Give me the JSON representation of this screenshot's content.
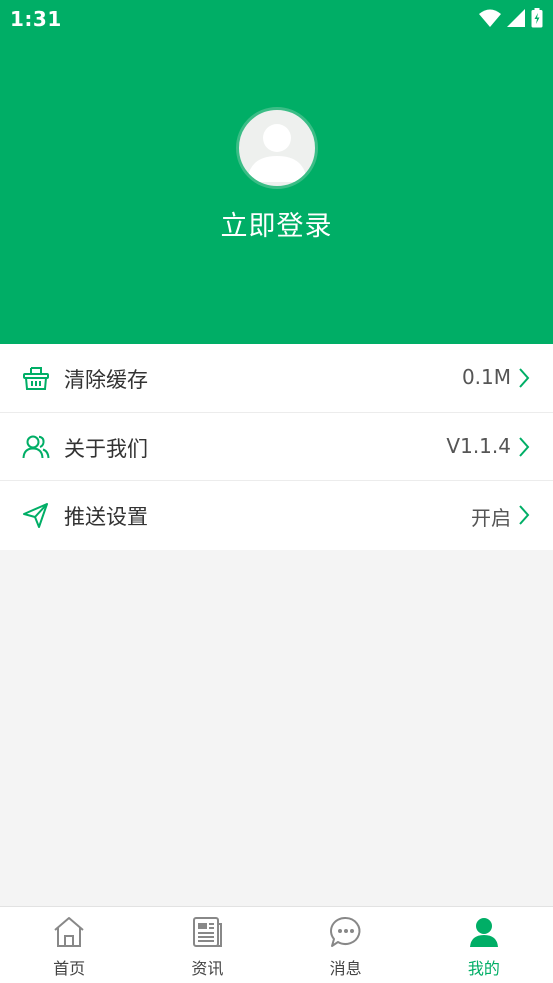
{
  "status_bar": {
    "time": "1:31"
  },
  "profile": {
    "login_text": "立即登录"
  },
  "menu": {
    "items": [
      {
        "label": "清除缓存",
        "value": "0.1M",
        "icon": "basket-icon"
      },
      {
        "label": "关于我们",
        "value": "V1.1.4",
        "icon": "users-icon"
      },
      {
        "label": "推送设置",
        "value": "开启",
        "icon": "send-icon"
      }
    ]
  },
  "tabbar": {
    "active": "我的",
    "tabs": [
      {
        "label": "首页",
        "icon": "home-icon"
      },
      {
        "label": "资讯",
        "icon": "news-icon"
      },
      {
        "label": "消息",
        "icon": "message-icon"
      },
      {
        "label": "我的",
        "icon": "person-icon"
      }
    ]
  },
  "colors": {
    "primary": "#00ae66",
    "background": "#f4f4f4",
    "text": "#333333"
  }
}
